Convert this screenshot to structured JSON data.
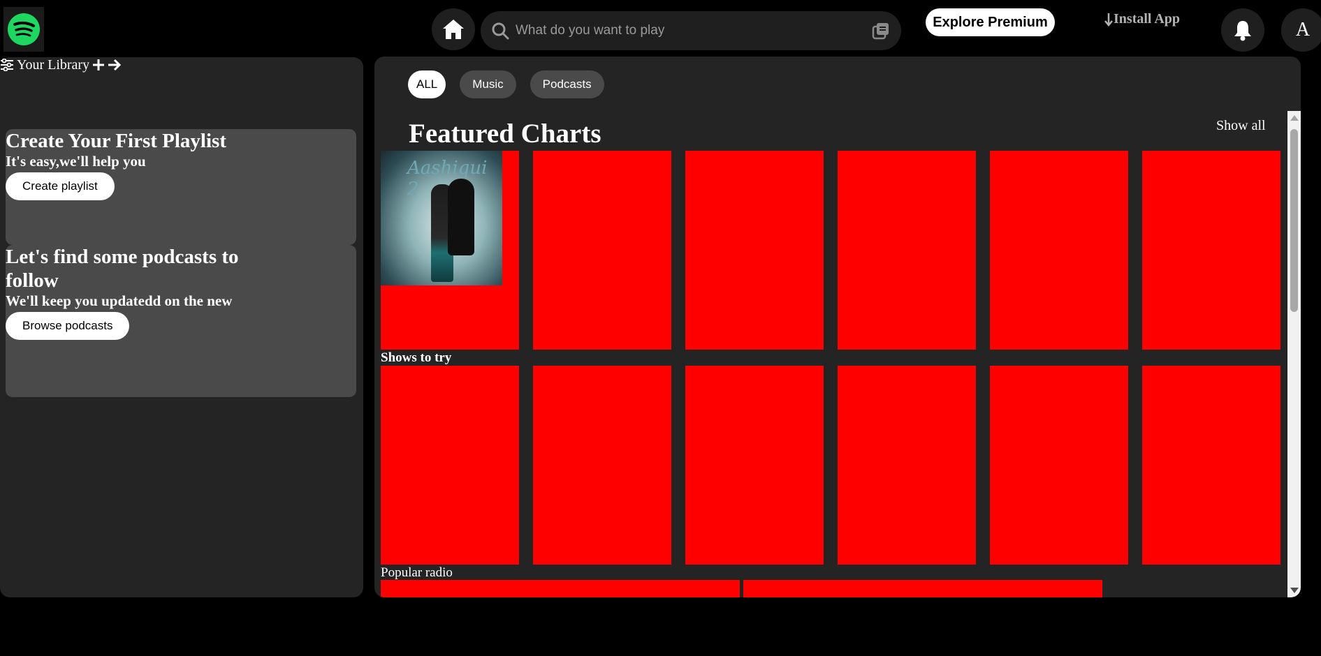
{
  "colors": {
    "brand": "#1ed760",
    "card": "#ff0000",
    "panel": "#242424",
    "card_bg": "#4a4a4a"
  },
  "topbar": {
    "search_placeholder": "What do you want to play",
    "premium_label": "Explore Premium",
    "install_label": "Install App",
    "avatar_letter": "A",
    "icons": [
      "spotify-logo",
      "home-icon",
      "search-icon",
      "browse-icon",
      "download-icon",
      "bell-icon"
    ]
  },
  "sidebar": {
    "library_label": "Your Library",
    "cards": [
      {
        "title": "Create Your First Playlist",
        "subtitle": "It's easy,we'll help you",
        "button": "Create playlist"
      },
      {
        "title": "Let's find some podcasts to follow",
        "subtitle": "We'll keep you updatedd on the new",
        "button": "Browse podcasts"
      }
    ]
  },
  "main": {
    "filters": [
      "ALL",
      "Music",
      "Podcasts"
    ],
    "active_filter": "ALL",
    "section_title": "Featured Charts",
    "show_all": "Show all",
    "row2_label": "Shows to try",
    "row3_label": "Popular radio",
    "featured_album_title": "Aashiqui 2"
  }
}
